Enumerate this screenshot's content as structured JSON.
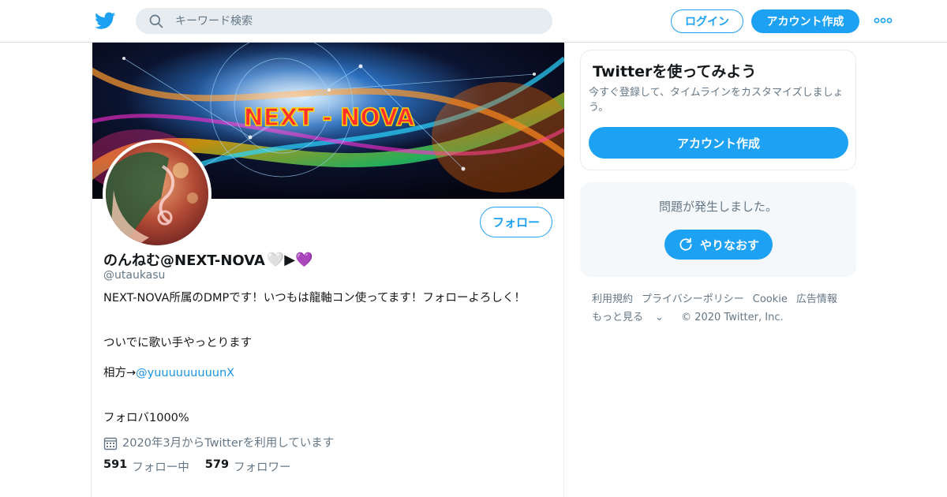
{
  "header": {
    "logo_icon": "twitter-bird-icon",
    "search_placeholder": "キーワード検索",
    "login_label": "ログイン",
    "signup_label": "アカウント作成",
    "more_icon": "more-dots-icon",
    "brand_color": "#1da1f2"
  },
  "profile": {
    "banner_text": "NEXT - NOVA",
    "name": "のんねむ@NEXT-NOVA",
    "name_emoji": "🤍▶💜",
    "handle": "@utaukasu",
    "follow_label": "フォロー",
    "bio": {
      "line1": "NEXT-NOVA所属のDMPです！いつもは龍軸コン使ってます！フォローよろしく！",
      "line2": "ついでに歌い手やっとります",
      "line3_prefix": "相方→",
      "line3_link": "@yuuuuuuuuunX",
      "line4": "フォロバ1000%"
    },
    "joined": "2020年3月からTwitterを利用しています",
    "following_count": "591",
    "following_label": "フォロー中",
    "followers_count": "579",
    "followers_label": "フォロワー"
  },
  "signup_card": {
    "title": "Twitterを使ってみよう",
    "description": "今すぐ登録して、タイムラインをカスタマイズしましょう。",
    "button_label": "アカウント作成"
  },
  "error_card": {
    "message": "問題が発生しました。",
    "retry_label": "やりなおす",
    "retry_icon": "refresh-icon"
  },
  "footer": {
    "links": [
      "利用規約",
      "プライバシーポリシー",
      "Cookie",
      "広告情報"
    ],
    "more_label": "もっと見る",
    "copyright": "© 2020 Twitter, Inc."
  }
}
